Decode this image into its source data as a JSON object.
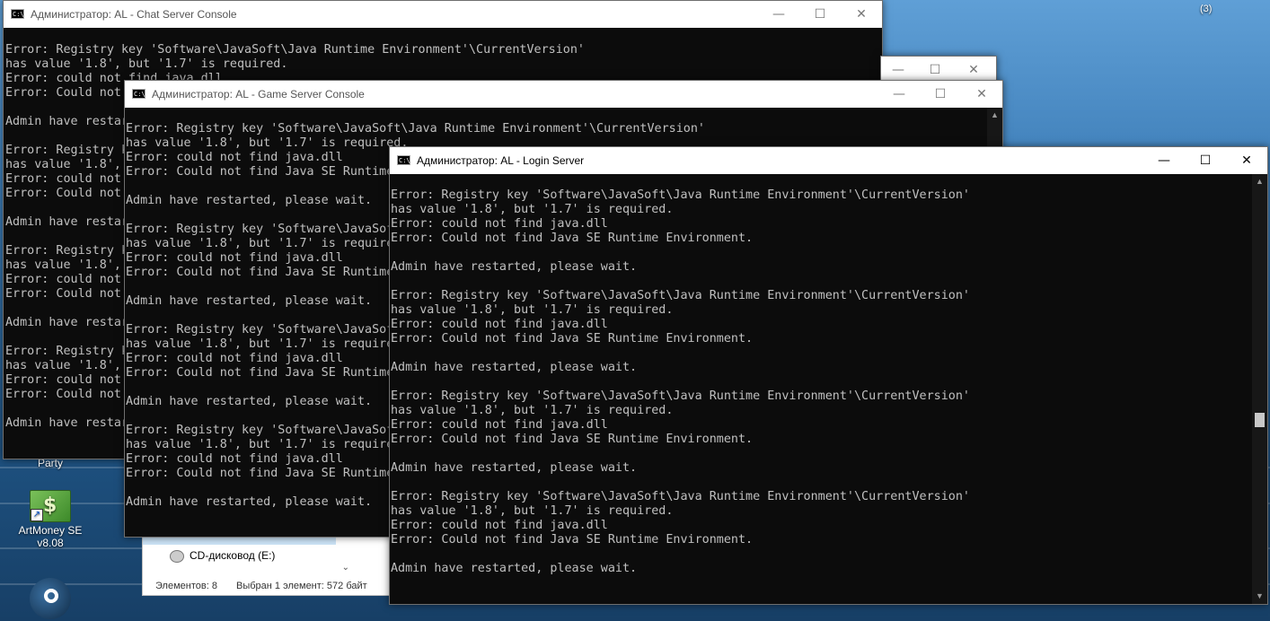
{
  "desktop": {
    "icons": [
      {
        "label": "Party",
        "icon": "folder-icon"
      },
      {
        "label": "ArtMoney SE\nv8.08",
        "icon": "artmoney-icon"
      },
      {
        "label": "",
        "icon": "steam-icon"
      }
    ],
    "tray_badge": "(3)"
  },
  "explorer": {
    "drive_label": "CD-дисковод (E:)",
    "status_items": "Элементов: 8",
    "status_selected": "Выбран 1 элемент: 572 байт"
  },
  "windows": {
    "chat": {
      "title": "Администратор:  AL - Chat Server Console",
      "lines": [
        "Error: Registry key 'Software\\JavaSoft\\Java Runtime Environment'\\CurrentVersion'",
        "has value '1.8', but '1.7' is required.",
        "Error: could not find java.dll",
        "Error: Could not find Java SE Runtime Environment.",
        "",
        "Admin have restarted, please wait.",
        "",
        "Error: Registry key 'Software\\JavaSoft\\Java Runtime Environment'\\CurrentVersion'",
        "has value '1.8', but '1.7' is required.",
        "Error: could not find java.dll",
        "Error: Could not find Java SE Runtime Environment.",
        "",
        "Admin have restarted, please wait.",
        "",
        "Error: Registry key 'Software\\JavaSoft\\Java Runtime Environment'\\CurrentVersion'",
        "has value '1.8', but '1.7' is required.",
        "Error: could not find java.dll",
        "Error: Could not find Java SE Runtime Environment.",
        "",
        "Admin have restarted, please wait.",
        "",
        "Error: Registry key 'Software\\JavaSoft\\Java Runtime Environment'\\CurrentVersion'",
        "has value '1.8', but '1.7' is required.",
        "Error: could not find java.dll",
        "Error: Could not find Java SE Runtime Environment.",
        "",
        "Admin have restarted, please wait."
      ]
    },
    "hidden": {
      "title": ""
    },
    "game": {
      "title": "Администратор:  AL - Game Server Console",
      "lines": [
        "Error: Registry key 'Software\\JavaSoft\\Java Runtime Environment'\\CurrentVersion'",
        "has value '1.8', but '1.7' is required.",
        "Error: could not find java.dll",
        "Error: Could not find Java SE Runtime Environment.",
        "",
        "Admin have restarted, please wait.",
        "",
        "Error: Registry key 'Software\\JavaSoft\\Java Runtime Environment'\\CurrentVersion'",
        "has value '1.8', but '1.7' is required.",
        "Error: could not find java.dll",
        "Error: Could not find Java SE Runtime Environment.",
        "",
        "Admin have restarted, please wait.",
        "",
        "Error: Registry key 'Software\\JavaSoft\\Java Runtime Environment'\\CurrentVersion'",
        "has value '1.8', but '1.7' is required.",
        "Error: could not find java.dll",
        "Error: Could not find Java SE Runtime Environment.",
        "",
        "Admin have restarted, please wait.",
        "",
        "Error: Registry key 'Software\\JavaSoft\\Java Runtime Environment'\\CurrentVersion'",
        "has value '1.8', but '1.7' is required.",
        "Error: could not find java.dll",
        "Error: Could not find Java SE Runtime Environment.",
        "",
        "Admin have restarted, please wait."
      ]
    },
    "login": {
      "title": "Администратор:  AL - Login Server",
      "lines": [
        "Error: Registry key 'Software\\JavaSoft\\Java Runtime Environment'\\CurrentVersion'",
        "has value '1.8', but '1.7' is required.",
        "Error: could not find java.dll",
        "Error: Could not find Java SE Runtime Environment.",
        "",
        "Admin have restarted, please wait.",
        "",
        "Error: Registry key 'Software\\JavaSoft\\Java Runtime Environment'\\CurrentVersion'",
        "has value '1.8', but '1.7' is required.",
        "Error: could not find java.dll",
        "Error: Could not find Java SE Runtime Environment.",
        "",
        "Admin have restarted, please wait.",
        "",
        "Error: Registry key 'Software\\JavaSoft\\Java Runtime Environment'\\CurrentVersion'",
        "has value '1.8', but '1.7' is required.",
        "Error: could not find java.dll",
        "Error: Could not find Java SE Runtime Environment.",
        "",
        "Admin have restarted, please wait.",
        "",
        "Error: Registry key 'Software\\JavaSoft\\Java Runtime Environment'\\CurrentVersion'",
        "has value '1.8', but '1.7' is required.",
        "Error: could not find java.dll",
        "Error: Could not find Java SE Runtime Environment.",
        "",
        "Admin have restarted, please wait."
      ],
      "scroll_position": 0.58
    }
  },
  "controls": {
    "minimize": "—",
    "maximize": "☐",
    "close": "✕"
  },
  "colors": {
    "console_bg": "#0c0c0c",
    "console_text": "#c0c0c0",
    "titlebar_bg": "#ffffff"
  }
}
